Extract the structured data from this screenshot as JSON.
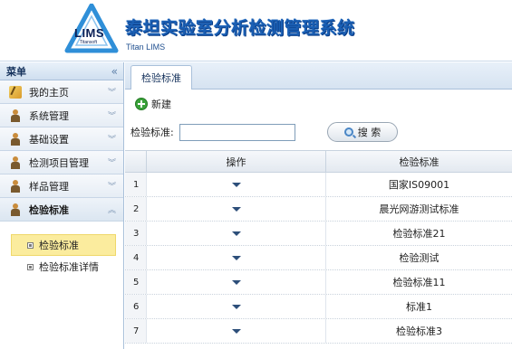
{
  "app": {
    "logo_text": "LIMS",
    "logo_sub": "Titansoft",
    "title": "泰坦实验室分析检测管理系统",
    "subtitle": "Titan LIMS"
  },
  "sidebar": {
    "title": "菜单",
    "items": [
      {
        "label": "我的主页",
        "icon": "home-icon"
      },
      {
        "label": "系统管理",
        "icon": "user-icon"
      },
      {
        "label": "基础设置",
        "icon": "user-icon"
      },
      {
        "label": "检测项目管理",
        "icon": "user-icon"
      },
      {
        "label": "样品管理",
        "icon": "user-icon"
      },
      {
        "label": "检验标准",
        "icon": "user-icon",
        "expanded": true
      }
    ],
    "sub_items": [
      {
        "label": "检验标准",
        "selected": true
      },
      {
        "label": "检验标准详情",
        "selected": false
      }
    ]
  },
  "tabs": [
    {
      "label": "检验标准"
    }
  ],
  "toolbar": {
    "new_label": "新建"
  },
  "search": {
    "label": "检验标准:",
    "value": "",
    "button_label": "搜 索"
  },
  "table": {
    "columns": [
      "",
      "操作",
      "检验标准"
    ],
    "rows": [
      {
        "num": "1",
        "standard": "国家IS09001"
      },
      {
        "num": "2",
        "standard": "晨光网游测试标准"
      },
      {
        "num": "3",
        "standard": "检验标准21"
      },
      {
        "num": "4",
        "standard": "检验测试"
      },
      {
        "num": "5",
        "standard": "检验标准11"
      },
      {
        "num": "6",
        "standard": "标准1"
      },
      {
        "num": "7",
        "standard": "检验标准3"
      }
    ]
  },
  "colors": {
    "accent": "#1a5fb4",
    "selected_bg": "#fbec9e",
    "border": "#a9c0da"
  }
}
